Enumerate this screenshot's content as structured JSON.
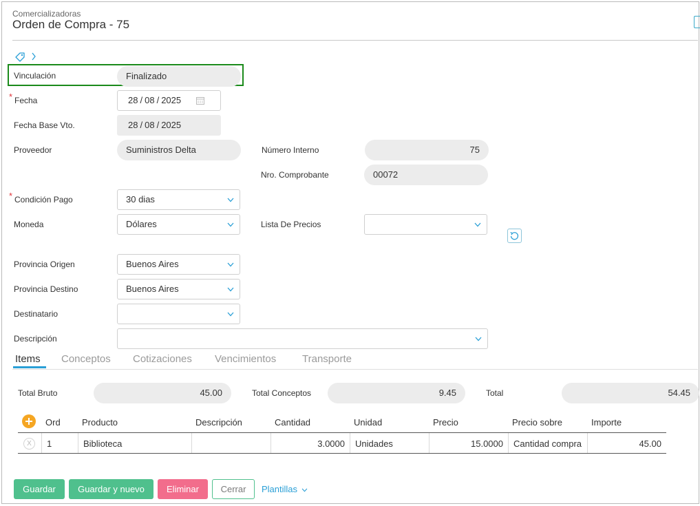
{
  "header": {
    "breadcrumb": "Comercializadoras",
    "title": "Orden de Compra - 75"
  },
  "form": {
    "vinculacion": {
      "label": "Vinculación",
      "value": "Finalizado"
    },
    "fecha": {
      "label": "Fecha",
      "day": "28",
      "month": "08",
      "year": "2025",
      "required": "*"
    },
    "fecha_base": {
      "label": "Fecha Base Vto.",
      "day": "28",
      "month": "08",
      "year": "2025"
    },
    "proveedor": {
      "label": "Proveedor",
      "value": "Suministros Delta"
    },
    "numero_interno": {
      "label": "Número Interno",
      "value": "75"
    },
    "nro_comprobante": {
      "label": "Nro. Comprobante",
      "value": "00072"
    },
    "condicion_pago": {
      "label": "Condición Pago",
      "value": "30 dias",
      "required": "*"
    },
    "moneda": {
      "label": "Moneda",
      "value": "Dólares"
    },
    "lista_precios": {
      "label": "Lista De Precios",
      "value": ""
    },
    "provincia_origen": {
      "label": "Provincia Origen",
      "value": "Buenos Aires"
    },
    "provincia_destino": {
      "label": "Provincia Destino",
      "value": "Buenos Aires"
    },
    "destinatario": {
      "label": "Destinatario",
      "value": ""
    },
    "descripcion": {
      "label": "Descripción",
      "value": ""
    }
  },
  "tabs": [
    {
      "label": "Items"
    },
    {
      "label": "Conceptos"
    },
    {
      "label": "Cotizaciones"
    },
    {
      "label": "Vencimientos"
    },
    {
      "label": "Transporte"
    }
  ],
  "totals": {
    "bruto": {
      "label": "Total Bruto",
      "value": "45.00"
    },
    "conceptos": {
      "label": "Total Conceptos",
      "value": "9.45"
    },
    "total": {
      "label": "Total",
      "value": "54.45"
    }
  },
  "table": {
    "columns": [
      "Ord",
      "Producto",
      "Descripción",
      "Cantidad",
      "Unidad",
      "Precio",
      "Precio sobre",
      "Importe"
    ],
    "rows": [
      {
        "delete": "X",
        "ord": "1",
        "producto": "Biblioteca",
        "descripcion": "",
        "cantidad": "3.0000",
        "unidad": "Unidades",
        "precio": "15.0000",
        "precio_sobre": "Cantidad compra",
        "importe": "45.00"
      }
    ]
  },
  "actions": {
    "guardar": "Guardar",
    "guardar_nuevo": "Guardar y nuevo",
    "eliminar": "Eliminar",
    "cerrar": "Cerrar",
    "plantillas": "Plantillas"
  },
  "colors": {
    "accent": "#2a9fd6",
    "success": "#4fc08d",
    "danger": "#f26d8c",
    "highlight": "#1a8a1a",
    "add": "#f5a623"
  }
}
